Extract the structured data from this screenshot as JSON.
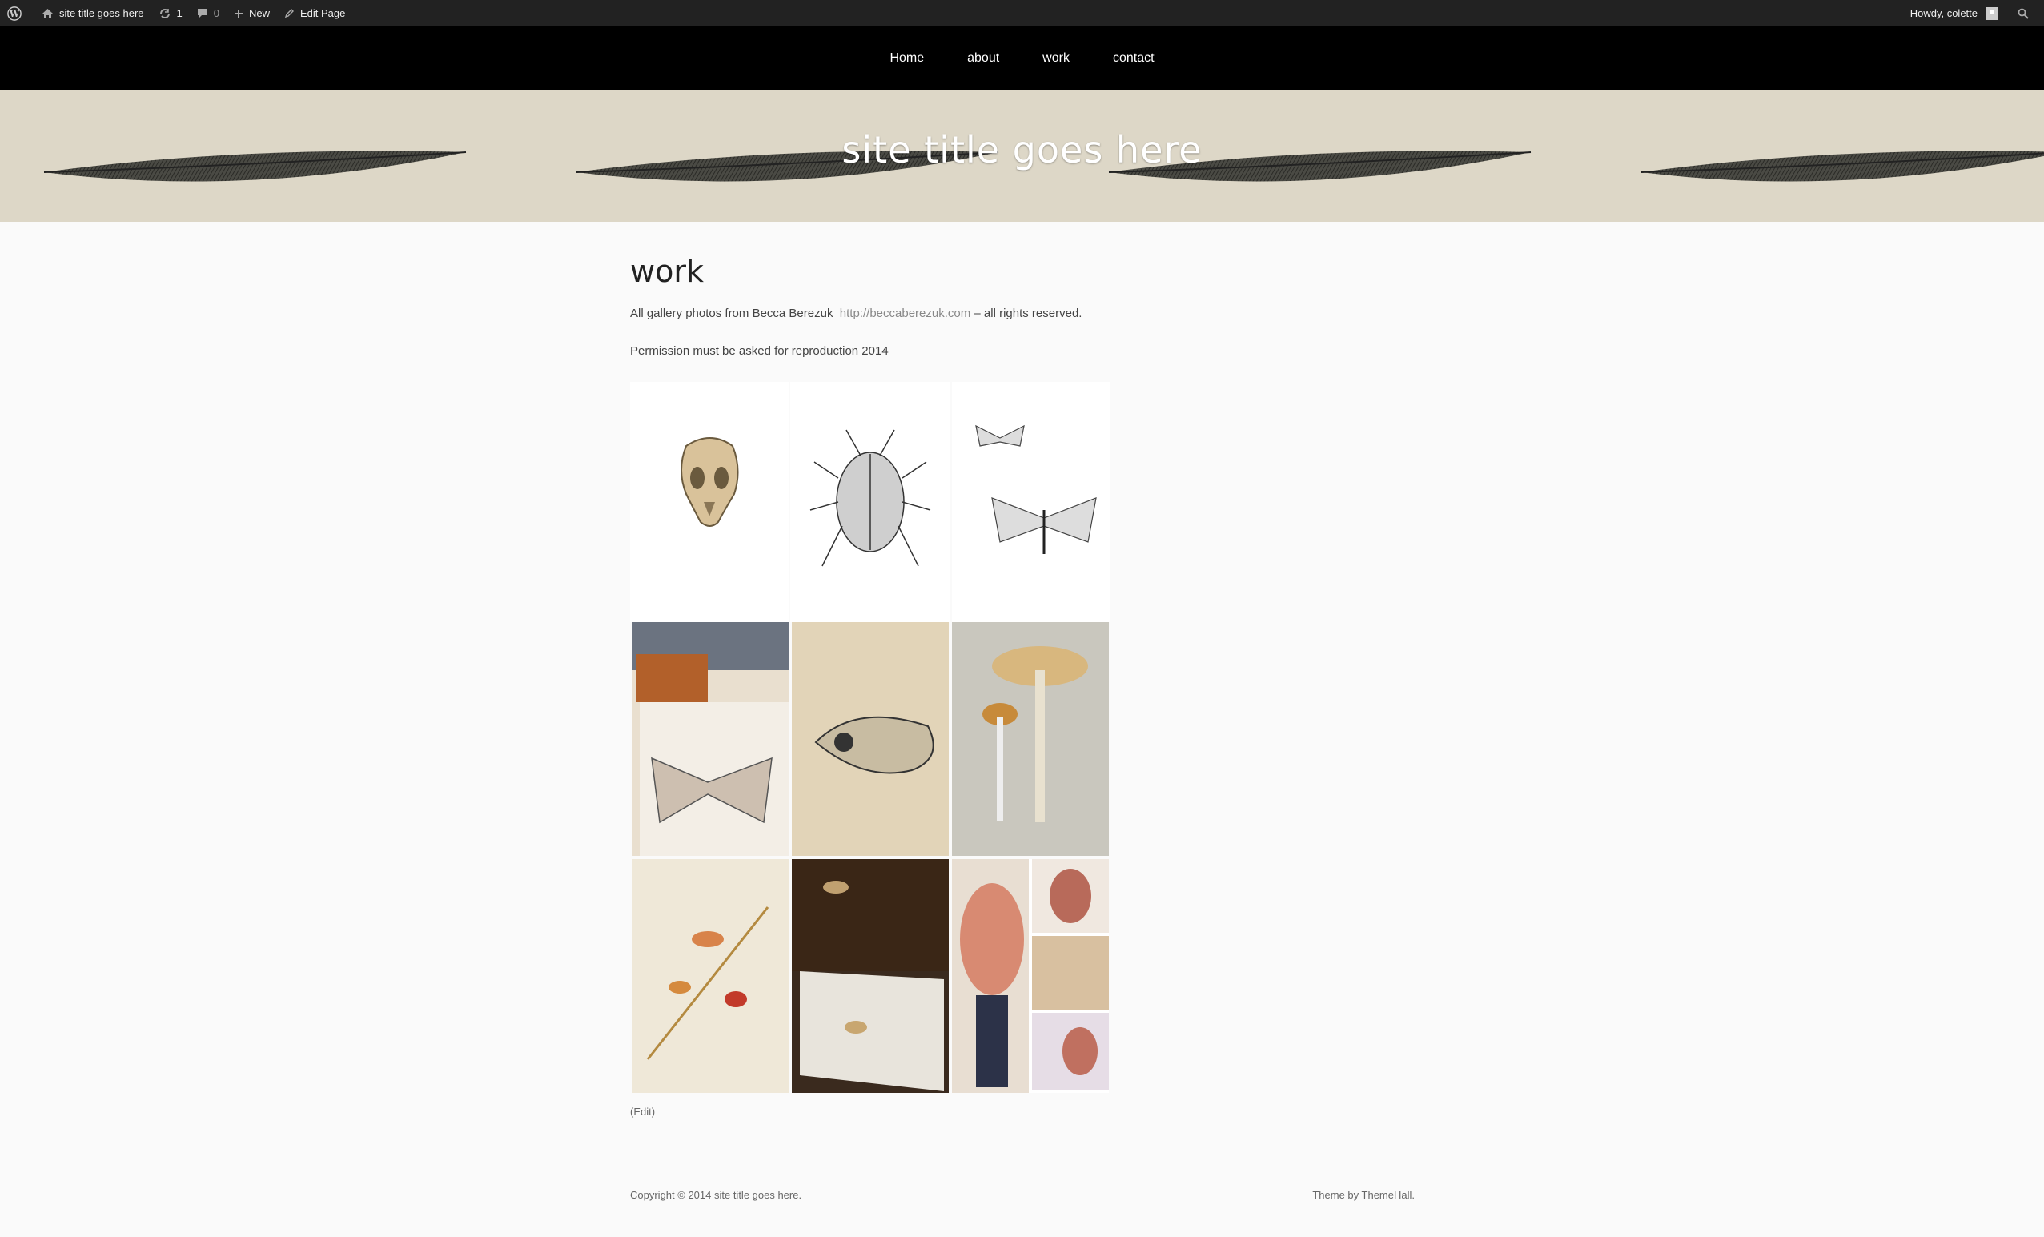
{
  "adminbar": {
    "site_title": "site title goes here",
    "updates_count": "1",
    "comments_count": "0",
    "new_label": "New",
    "edit_page_label": "Edit Page",
    "greeting": "Howdy, colette"
  },
  "nav": {
    "items": [
      "Home",
      "about",
      "work",
      "contact"
    ]
  },
  "header": {
    "site_title": "site title goes here"
  },
  "page": {
    "title": "work",
    "intro_text": "All gallery photos from Becca Berezuk",
    "intro_link": "http://beccaberezuk.com",
    "intro_suffix": "– all rights reserved.",
    "permission": "Permission must be asked for reproduction 2014",
    "edit_label": "(Edit)"
  },
  "gallery": {
    "items": [
      "skull-drawing",
      "shield-bug-drawing",
      "moths-drawing",
      "moth-sketch-desk-photo",
      "skull-sketch-photo",
      "mushroom-painting",
      "mushroom-studies-photo",
      "mushroom-painting-desk-photo",
      "anatomy-sculpture-collage"
    ]
  },
  "footer": {
    "copyright": "Copyright © 2014 site title goes here.",
    "credit": "Theme by ThemeHall."
  }
}
